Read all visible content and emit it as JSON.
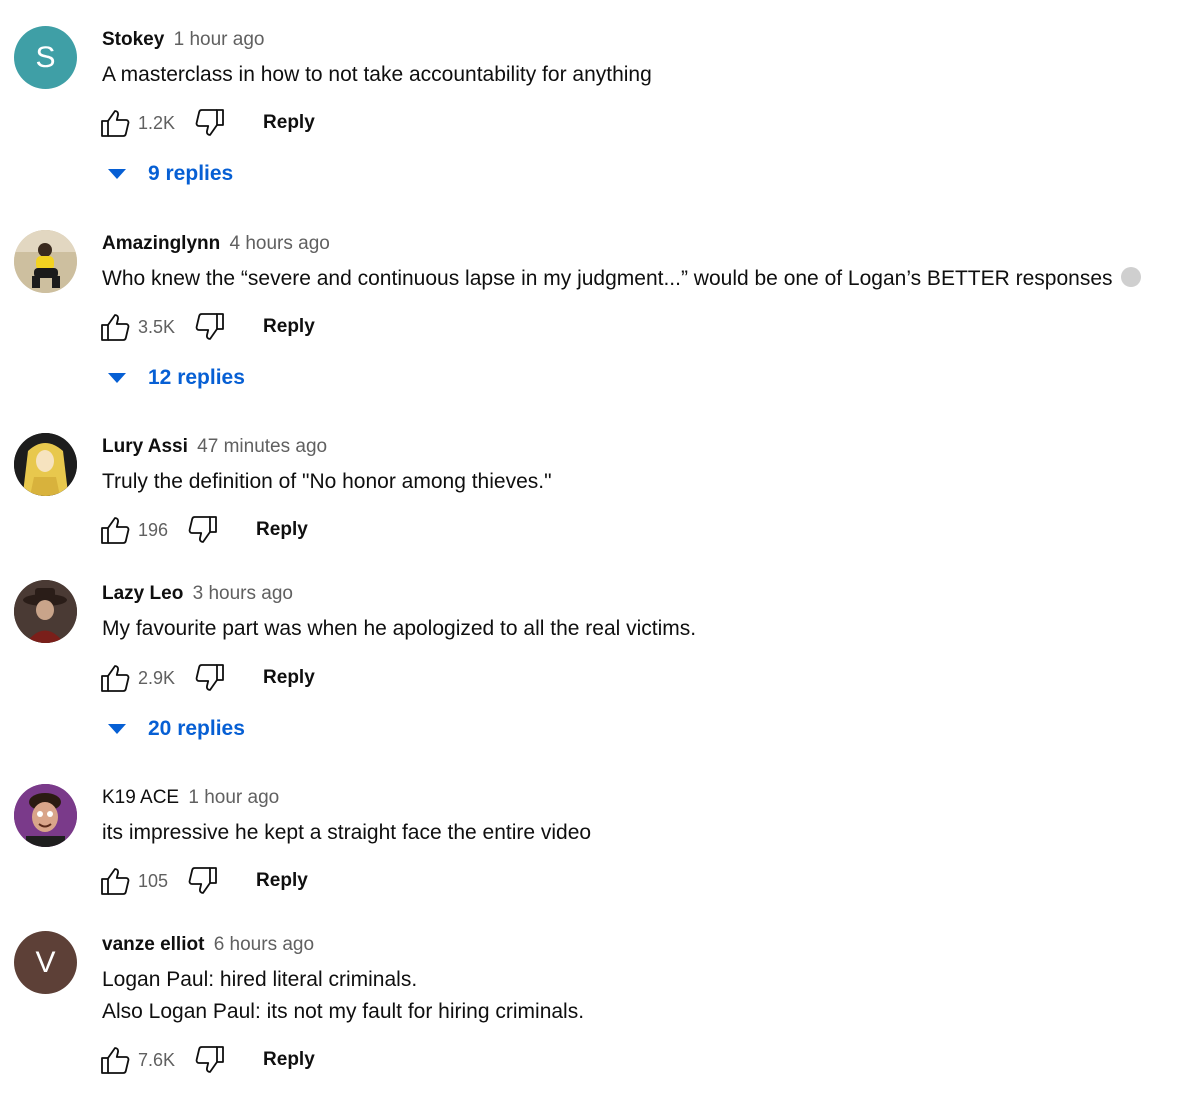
{
  "comments": [
    {
      "author": "Stokey",
      "time": "1 hour ago",
      "avatar_letter": "S",
      "avatar_color": "#3f9fa6",
      "lines": [
        "A masterclass in how to not take accountability for anything"
      ],
      "likes": "1.2K",
      "reply_label": "Reply",
      "replies_label": "9 replies"
    },
    {
      "author": "Amazinglynn",
      "time": "4 hours ago",
      "avatar_letter": "",
      "lines": [
        "Who knew the “severe and continuous lapse in my judgment...” would be one of Logan’s BETTER responses"
      ],
      "likes": "3.5K",
      "reply_label": "Reply",
      "replies_label": "12 replies"
    },
    {
      "author": "Lury Assi",
      "time": "47 minutes ago",
      "avatar_letter": "",
      "lines": [
        "Truly the definition of \"No honor among thieves.\""
      ],
      "likes": "196",
      "reply_label": "Reply",
      "replies_label": ""
    },
    {
      "author": "Lazy Leo",
      "time": "3 hours ago",
      "avatar_letter": "",
      "lines": [
        "My favourite part was when he apologized to all the real victims."
      ],
      "likes": "2.9K",
      "reply_label": "Reply",
      "replies_label": "20 replies"
    },
    {
      "author": "K19 ACE",
      "time": "1 hour ago",
      "avatar_letter": "",
      "lines": [
        "its impressive he kept a straight face the entire video"
      ],
      "likes": "105",
      "reply_label": "Reply",
      "replies_label": ""
    },
    {
      "author": "vanze elliot",
      "time": "6 hours ago",
      "avatar_letter": "V",
      "avatar_color": "#5d4037",
      "lines": [
        "Logan Paul: hired literal criminals.",
        "Also Logan Paul: its not my fault for hiring criminals."
      ],
      "likes": "7.6K",
      "reply_label": "Reply",
      "replies_label": ""
    }
  ]
}
